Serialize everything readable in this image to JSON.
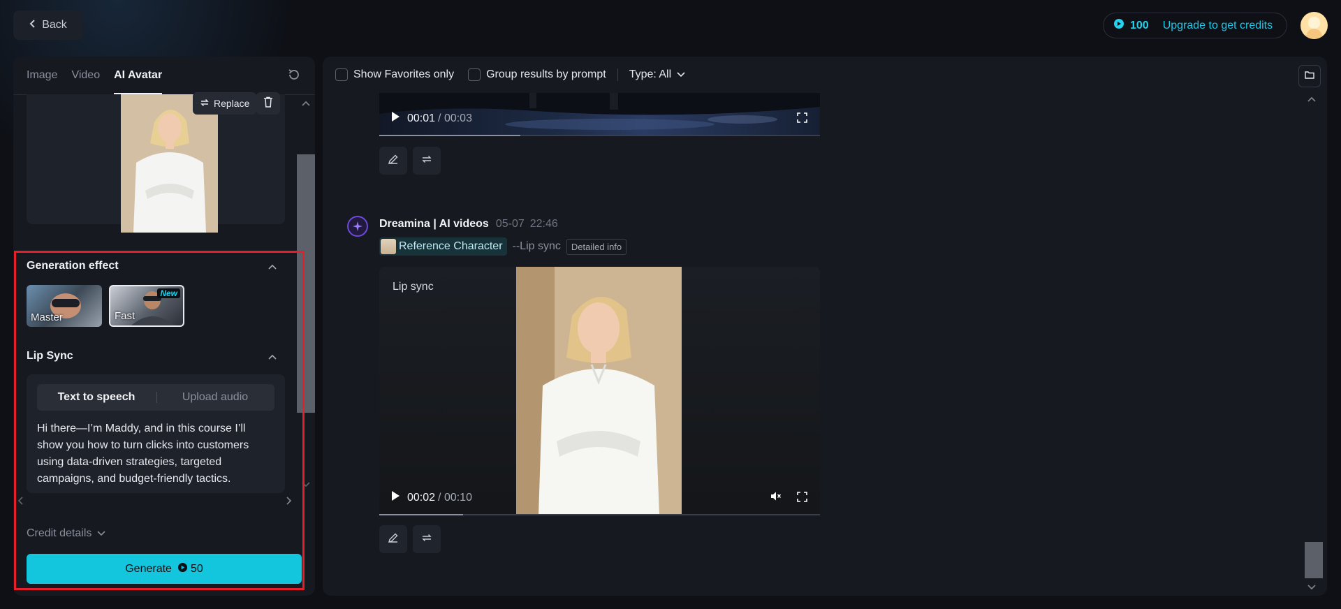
{
  "topbar": {
    "back_label": "Back",
    "credits": "100",
    "upgrade_label": "Upgrade to get credits"
  },
  "left": {
    "tabs": [
      {
        "label": "Image",
        "active": false
      },
      {
        "label": "Video",
        "active": false
      },
      {
        "label": "AI Avatar",
        "active": true
      }
    ],
    "replace_label": "Replace",
    "generation_effect": {
      "title": "Generation effect",
      "options": [
        {
          "label": "Master",
          "selected": false
        },
        {
          "label": "Fast",
          "selected": true,
          "badge": "New"
        }
      ]
    },
    "lip_sync": {
      "title": "Lip Sync",
      "modes": [
        "Text to speech",
        "Upload audio"
      ],
      "active_mode": "Text to speech",
      "text": "Hi there—I’m Maddy, and in this course I’ll show you how to turn clicks into customers using data-driven strategies, targeted campaigns, and budget-friendly tactics."
    },
    "credit_details_label": "Credit details",
    "generate": {
      "label": "Generate",
      "cost": "50"
    }
  },
  "right": {
    "filters": {
      "favorites_label": "Show Favorites only",
      "group_label": "Group results by prompt",
      "type_label": "Type: All"
    },
    "video1": {
      "current": "00:01",
      "duration": "/ 00:03",
      "progress": 0.32
    },
    "entry": {
      "author": "Dreamina | AI videos",
      "date": "05-07",
      "time": "22:46",
      "ref_label": "Reference Character",
      "type_label": "--Lip sync",
      "detail_label": "Detailed info"
    },
    "video2": {
      "label": "Lip sync",
      "current": "00:02",
      "duration": "/ 00:10",
      "progress": 0.19
    }
  },
  "colors": {
    "accent": "#14c6dd",
    "highlight": "#e5202b"
  }
}
